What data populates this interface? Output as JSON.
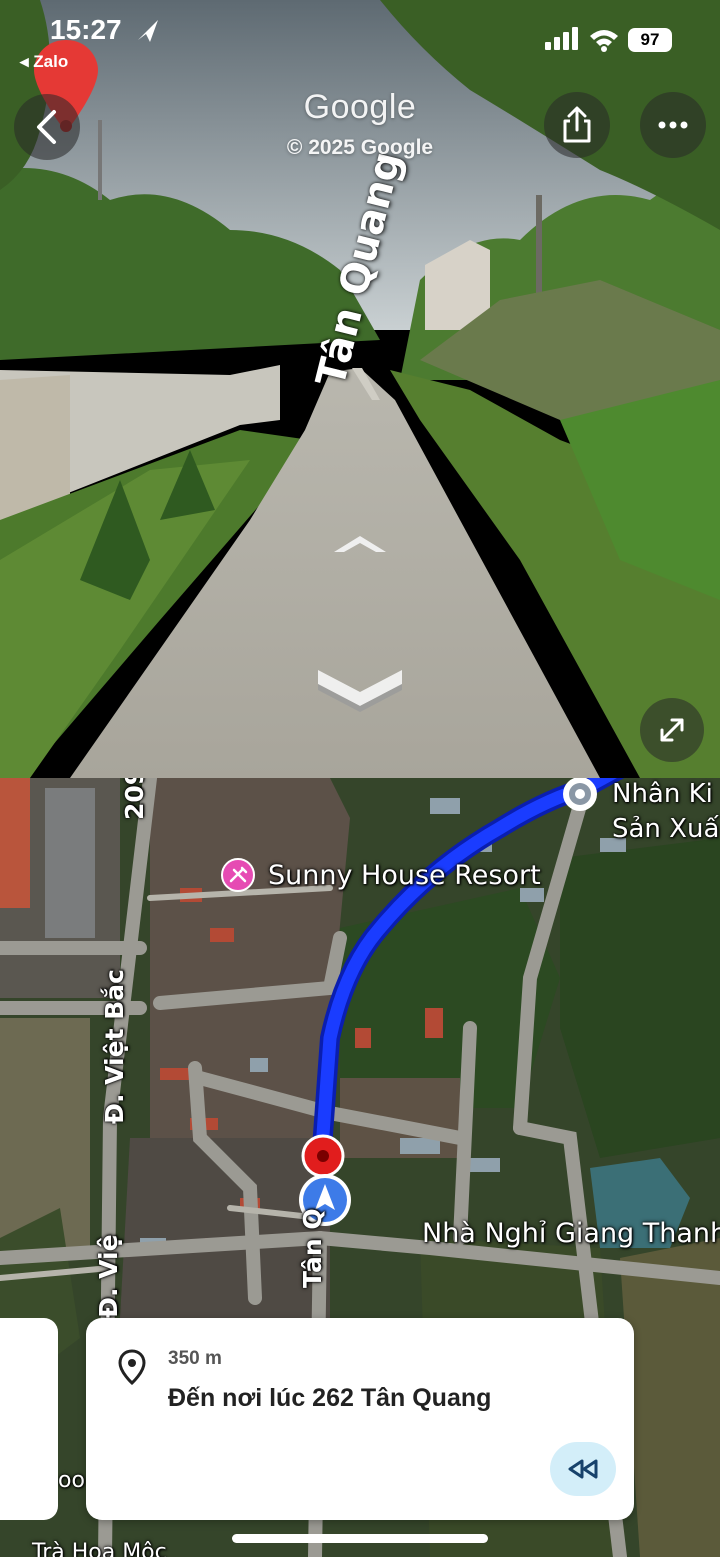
{
  "status_bar": {
    "time": "15:27",
    "back_app": "◂ Zalo",
    "battery": "97"
  },
  "street_view": {
    "watermark": "Google",
    "copyright": "© 2025 Google",
    "road_label": "Tân Quang",
    "buttons": {
      "back": "back-chevron-icon",
      "share": "share-icon",
      "more": "more-dots-icon",
      "expand": "expand-diagonal-icon"
    }
  },
  "map": {
    "labels": {
      "sunny": "Sunny House Resort",
      "nhan1": "Nhân Ki",
      "nhan2": "Sản Xuấ",
      "nghi": "Nhà Nghỉ Giang Thanh",
      "road_209": "209",
      "viet_bac_1": "Đ. Việt Bắc",
      "viet_bac_2": "Đ. Việ",
      "tan": "Tân Q",
      "tra_hoa": "Trà Hoa Mộc",
      "boo": "oo"
    },
    "colors": {
      "route": "#1a3cff",
      "route_outline": "#0a1eb0",
      "resort_pin": "#e64bb3"
    }
  },
  "instruction": {
    "distance": "350 m",
    "destination": "Đến nơi lúc 262 Tân Quang"
  }
}
